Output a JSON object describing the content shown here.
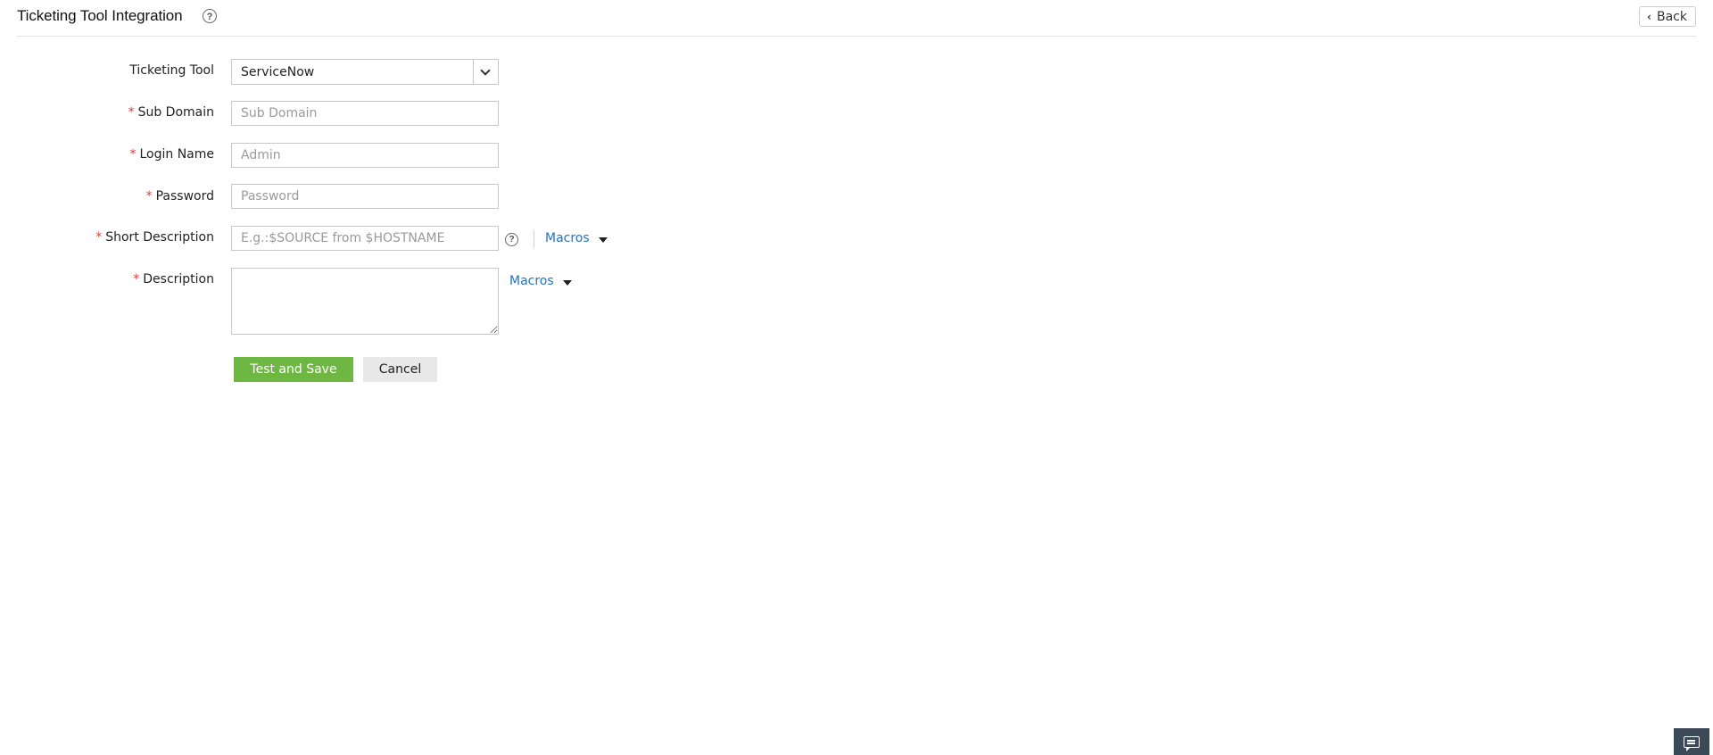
{
  "header": {
    "title": "Ticketing Tool Integration",
    "help_icon": "question-circle-icon",
    "back_label": "Back",
    "back_icon": "chevron-left-icon"
  },
  "form": {
    "ticketing_tool": {
      "label": "Ticketing Tool",
      "value": "ServiceNow"
    },
    "sub_domain": {
      "label": "Sub Domain",
      "required_mark": "*",
      "placeholder": "Sub Domain",
      "value": ""
    },
    "login_name": {
      "label": "Login Name",
      "required_mark": "*",
      "placeholder": "Admin",
      "value": ""
    },
    "password": {
      "label": "Password",
      "required_mark": "*",
      "placeholder": "Password",
      "value": ""
    },
    "short_description": {
      "label": "Short Description",
      "required_mark": "*",
      "placeholder": "E.g.:$SOURCE from $HOSTNAME",
      "value": "",
      "macros_label": "Macros"
    },
    "description": {
      "label": "Description",
      "required_mark": "*",
      "value": "",
      "macros_label": "Macros"
    }
  },
  "actions": {
    "test_and_save": "Test and Save",
    "cancel": "Cancel"
  },
  "colors": {
    "primary_button": "#6fb743",
    "link": "#1f74bf",
    "required": "#e03c3c",
    "chat_button": "#3b4a56"
  },
  "chat": {
    "icon": "chat-icon"
  }
}
